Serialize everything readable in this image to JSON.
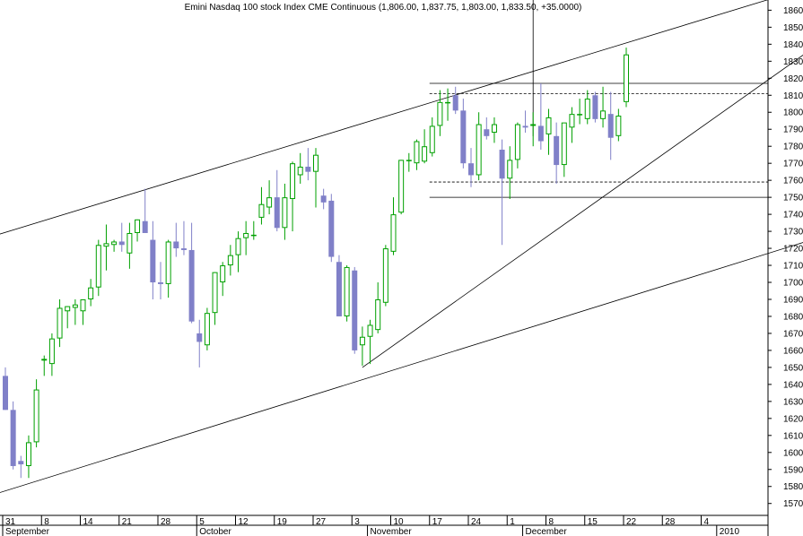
{
  "chart_data": {
    "type": "candlestick",
    "title": "Emini Nasdaq 100 stock Index CME Continuous (1,806.00, 1,837.75, 1,803.00, 1,833.50, +35.0000)",
    "y_ticks": [
      1570,
      1580,
      1590,
      1600,
      1610,
      1620,
      1630,
      1640,
      1650,
      1660,
      1670,
      1680,
      1690,
      1700,
      1710,
      1720,
      1730,
      1740,
      1750,
      1760,
      1770,
      1780,
      1790,
      1800,
      1810,
      1820,
      1830,
      1840,
      1850,
      1860
    ],
    "ylim": [
      1563,
      1866
    ],
    "x_day_ticks": [
      "31",
      "8",
      "14",
      "21",
      "28",
      "5",
      "12",
      "19",
      "27",
      "3",
      "10",
      "17",
      "24",
      "1",
      "8",
      "15",
      "22",
      "28",
      "4"
    ],
    "x_month_labels": [
      "September",
      "October",
      "November",
      "December",
      "2010"
    ],
    "colors": {
      "up": "#00a000",
      "down": "#8080c8",
      "line": "#000000",
      "axis": "#000000"
    },
    "candles": [
      {
        "o": 1645,
        "h": 1650,
        "l": 1625,
        "c": 1625
      },
      {
        "o": 1625,
        "h": 1630,
        "l": 1590,
        "c": 1592
      },
      {
        "o": 1595,
        "h": 1598,
        "l": 1585,
        "c": 1593
      },
      {
        "o": 1592,
        "h": 1610,
        "l": 1585,
        "c": 1606
      },
      {
        "o": 1606,
        "h": 1643,
        "l": 1603,
        "c": 1637
      },
      {
        "o": 1654,
        "h": 1657,
        "l": 1645,
        "c": 1655
      },
      {
        "o": 1652,
        "h": 1670,
        "l": 1645,
        "c": 1667
      },
      {
        "o": 1667,
        "h": 1690,
        "l": 1662,
        "c": 1685
      },
      {
        "o": 1683,
        "h": 1686,
        "l": 1673,
        "c": 1686
      },
      {
        "o": 1685,
        "h": 1690,
        "l": 1675,
        "c": 1687
      },
      {
        "o": 1683,
        "h": 1690,
        "l": 1675,
        "c": 1690
      },
      {
        "o": 1690,
        "h": 1702,
        "l": 1686,
        "c": 1697
      },
      {
        "o": 1697,
        "h": 1725,
        "l": 1692,
        "c": 1722
      },
      {
        "o": 1721,
        "h": 1734,
        "l": 1707,
        "c": 1723
      },
      {
        "o": 1722,
        "h": 1725,
        "l": 1718,
        "c": 1724
      },
      {
        "o": 1724,
        "h": 1735,
        "l": 1718,
        "c": 1722
      },
      {
        "o": 1717,
        "h": 1735,
        "l": 1708,
        "c": 1729
      },
      {
        "o": 1729,
        "h": 1737,
        "l": 1724,
        "c": 1737
      },
      {
        "o": 1736,
        "h": 1755,
        "l": 1733,
        "c": 1729
      },
      {
        "o": 1725,
        "h": 1736,
        "l": 1690,
        "c": 1700
      },
      {
        "o": 1700,
        "h": 1712,
        "l": 1690,
        "c": 1699
      },
      {
        "o": 1699,
        "h": 1725,
        "l": 1691,
        "c": 1724
      },
      {
        "o": 1724,
        "h": 1735,
        "l": 1715,
        "c": 1720
      },
      {
        "o": 1720,
        "h": 1736,
        "l": 1716,
        "c": 1719
      },
      {
        "o": 1719,
        "h": 1735,
        "l": 1676,
        "c": 1677
      },
      {
        "o": 1670,
        "h": 1678,
        "l": 1650,
        "c": 1665
      },
      {
        "o": 1663,
        "h": 1685,
        "l": 1660,
        "c": 1682
      },
      {
        "o": 1682,
        "h": 1706,
        "l": 1675,
        "c": 1706
      },
      {
        "o": 1700,
        "h": 1712,
        "l": 1692,
        "c": 1710
      },
      {
        "o": 1710,
        "h": 1722,
        "l": 1704,
        "c": 1716
      },
      {
        "o": 1716,
        "h": 1730,
        "l": 1706,
        "c": 1726
      },
      {
        "o": 1726,
        "h": 1736,
        "l": 1716,
        "c": 1729
      },
      {
        "o": 1728,
        "h": 1736,
        "l": 1725,
        "c": 1728
      },
      {
        "o": 1738,
        "h": 1756,
        "l": 1734,
        "c": 1746
      },
      {
        "o": 1744,
        "h": 1760,
        "l": 1740,
        "c": 1750
      },
      {
        "o": 1750,
        "h": 1766,
        "l": 1730,
        "c": 1732
      },
      {
        "o": 1732,
        "h": 1758,
        "l": 1725,
        "c": 1750
      },
      {
        "o": 1749,
        "h": 1771,
        "l": 1730,
        "c": 1770
      },
      {
        "o": 1763,
        "h": 1776,
        "l": 1758,
        "c": 1768
      },
      {
        "o": 1768,
        "h": 1779,
        "l": 1760,
        "c": 1765
      },
      {
        "o": 1765,
        "h": 1779,
        "l": 1744,
        "c": 1775
      },
      {
        "o": 1751,
        "h": 1755,
        "l": 1743,
        "c": 1747
      },
      {
        "o": 1748,
        "h": 1752,
        "l": 1712,
        "c": 1715
      },
      {
        "o": 1712,
        "h": 1716,
        "l": 1680,
        "c": 1680
      },
      {
        "o": 1680,
        "h": 1710,
        "l": 1677,
        "c": 1709
      },
      {
        "o": 1707,
        "h": 1709,
        "l": 1658,
        "c": 1660
      },
      {
        "o": 1663,
        "h": 1674,
        "l": 1651,
        "c": 1668
      },
      {
        "o": 1668,
        "h": 1678,
        "l": 1652,
        "c": 1675
      },
      {
        "o": 1672,
        "h": 1700,
        "l": 1670,
        "c": 1690
      },
      {
        "o": 1688,
        "h": 1722,
        "l": 1686,
        "c": 1720
      },
      {
        "o": 1718,
        "h": 1750,
        "l": 1716,
        "c": 1740
      },
      {
        "o": 1741,
        "h": 1772,
        "l": 1740,
        "c": 1772
      },
      {
        "o": 1772,
        "h": 1776,
        "l": 1765,
        "c": 1772
      },
      {
        "o": 1770,
        "h": 1784,
        "l": 1766,
        "c": 1783
      },
      {
        "o": 1771,
        "h": 1790,
        "l": 1770,
        "c": 1780
      },
      {
        "o": 1776,
        "h": 1797,
        "l": 1774,
        "c": 1792
      },
      {
        "o": 1792,
        "h": 1813,
        "l": 1786,
        "c": 1806
      },
      {
        "o": 1806,
        "h": 1814,
        "l": 1795,
        "c": 1806
      },
      {
        "o": 1810,
        "h": 1815,
        "l": 1799,
        "c": 1801
      },
      {
        "o": 1801,
        "h": 1808,
        "l": 1767,
        "c": 1770
      },
      {
        "o": 1770,
        "h": 1779,
        "l": 1756,
        "c": 1763
      },
      {
        "o": 1763,
        "h": 1800,
        "l": 1760,
        "c": 1793
      },
      {
        "o": 1790,
        "h": 1797,
        "l": 1784,
        "c": 1786
      },
      {
        "o": 1788,
        "h": 1797,
        "l": 1782,
        "c": 1793
      },
      {
        "o": 1778,
        "h": 1784,
        "l": 1722,
        "c": 1761
      },
      {
        "o": 1761,
        "h": 1780,
        "l": 1749,
        "c": 1772
      },
      {
        "o": 1772,
        "h": 1794,
        "l": 1767,
        "c": 1793
      },
      {
        "o": 1792,
        "h": 1801,
        "l": 1788,
        "c": 1791
      },
      {
        "o": 1792,
        "h": 1800,
        "l": 1780,
        "c": 1793
      },
      {
        "o": 1792,
        "h": 1817,
        "l": 1778,
        "c": 1783
      },
      {
        "o": 1787,
        "h": 1802,
        "l": 1775,
        "c": 1797
      },
      {
        "o": 1786,
        "h": 1794,
        "l": 1758,
        "c": 1769
      },
      {
        "o": 1769,
        "h": 1792,
        "l": 1762,
        "c": 1794
      },
      {
        "o": 1791,
        "h": 1803,
        "l": 1782,
        "c": 1799
      },
      {
        "o": 1799,
        "h": 1808,
        "l": 1793,
        "c": 1799
      },
      {
        "o": 1796,
        "h": 1813,
        "l": 1793,
        "c": 1808
      },
      {
        "o": 1810,
        "h": 1812,
        "l": 1794,
        "c": 1796
      },
      {
        "o": 1796,
        "h": 1815,
        "l": 1791,
        "c": 1801
      },
      {
        "o": 1799,
        "h": 1812,
        "l": 1772,
        "c": 1785
      },
      {
        "o": 1786,
        "h": 1802,
        "l": 1783,
        "c": 1798
      },
      {
        "o": 1806,
        "h": 1838,
        "l": 1803,
        "c": 1834
      }
    ],
    "trendlines": [
      {
        "from": {
          "i": -1,
          "y": 1728
        },
        "to": {
          "i": 101,
          "y": 1870
        }
      },
      {
        "from": {
          "i": -1,
          "y": 1576
        },
        "to": {
          "i": 106,
          "y": 1728
        }
      },
      {
        "from": {
          "i": 46,
          "y": 1650
        },
        "to": {
          "i": 106,
          "y": 1844
        }
      },
      {
        "from": {
          "i": 68,
          "y": 1786
        },
        "to": {
          "i": 68,
          "y": 1870
        }
      }
    ],
    "hlines": [
      {
        "y": 1817,
        "from": 55,
        "style": "solid"
      },
      {
        "y": 1811,
        "from": 55,
        "style": "dashed"
      },
      {
        "y": 1759,
        "from": 55,
        "style": "dashed"
      },
      {
        "y": 1750,
        "from": 55,
        "style": "solid"
      }
    ],
    "day_tick_indices": [
      0,
      5,
      10,
      15,
      20,
      25,
      30,
      35,
      40,
      45,
      50,
      55,
      60,
      65,
      70,
      75,
      80,
      85,
      90
    ],
    "month_label_indices": [
      0,
      25,
      47,
      67,
      92
    ]
  }
}
